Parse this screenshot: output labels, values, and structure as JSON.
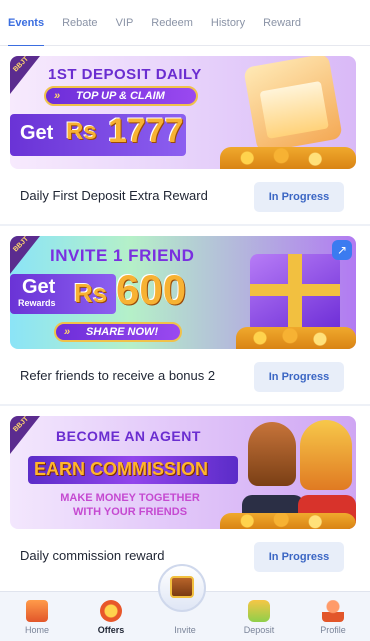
{
  "tabs": [
    {
      "label": "Events",
      "active": true
    },
    {
      "label": "Rebate",
      "active": false
    },
    {
      "label": "VIP",
      "active": false
    },
    {
      "label": "Redeem",
      "active": false
    },
    {
      "label": "History",
      "active": false
    },
    {
      "label": "Reward",
      "active": false
    }
  ],
  "cards": [
    {
      "ribbon": "BBJT",
      "headline": "1ST DEPOSIT DAILY",
      "pill": "TOP UP & CLAIM",
      "get": "Get",
      "currency": "Rs",
      "amount": "1777",
      "title": "Daily First Deposit Extra Reward",
      "status": "In Progress"
    },
    {
      "ribbon": "BBJT",
      "headline": "INVITE 1 FRIEND",
      "get": "Get",
      "get_sub": "Rewards",
      "currency": "Rs",
      "amount": "600",
      "pill": "SHARE NOW!",
      "title": "Refer friends to receive a bonus 2",
      "status": "In Progress"
    },
    {
      "ribbon": "BBJT",
      "headline": "BECOME AN AGENT",
      "earn": "EARN COMMISSION",
      "sub_line1": "MAKE MONEY TOGETHER",
      "sub_line2": "WITH YOUR FRIENDS",
      "title": "Daily commission reward",
      "status": "In Progress"
    }
  ],
  "bottom_nav": [
    {
      "label": "Home",
      "icon": "home-icon",
      "active": false
    },
    {
      "label": "Offers",
      "icon": "offers-icon",
      "active": true
    },
    {
      "label": "Invite",
      "icon": "treasure-chest-icon",
      "active": false
    },
    {
      "label": "Deposit",
      "icon": "deposit-icon",
      "active": false
    },
    {
      "label": "Profile",
      "icon": "profile-icon",
      "active": false
    }
  ],
  "colors": {
    "accent": "#3b6ee0",
    "status_bg": "#e8eef9",
    "status_text": "#3b66c4",
    "page_bg": "#eef1f7"
  }
}
